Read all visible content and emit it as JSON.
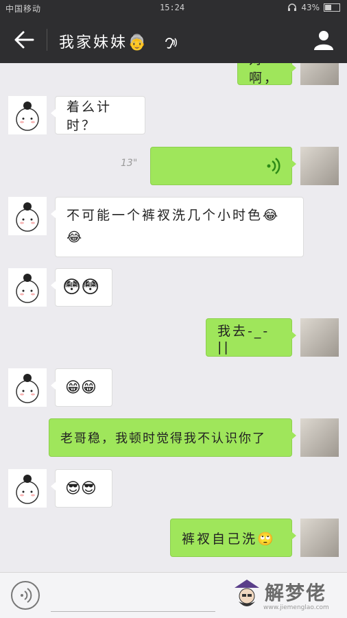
{
  "status_bar": {
    "carrier": "中国移动",
    "time": "15:24",
    "battery": "43%",
    "battery_level": 0.43
  },
  "header": {
    "title": "我家妹妹👵",
    "ear_icon": "ear-icon",
    "back_icon": "back-arrow-icon",
    "profile_icon": "person-icon"
  },
  "messages": [
    {
      "side": "right",
      "text": "对啊，"
    },
    {
      "side": "left",
      "text": "着么计时？"
    },
    {
      "side": "right",
      "type": "voice",
      "duration": "13\""
    },
    {
      "side": "left",
      "text": "不可能一个裤衩洗几个小时色😂😂"
    },
    {
      "side": "left",
      "text": "😳😳"
    },
    {
      "side": "right",
      "text": "我去-_-||"
    },
    {
      "side": "left",
      "text": "😁😁"
    },
    {
      "side": "right",
      "text": "老哥稳，我顿时觉得我不认识你了"
    },
    {
      "side": "left",
      "text": "😎😎"
    },
    {
      "side": "right",
      "text": "裤衩自己洗🙄"
    }
  ],
  "watermark": {
    "text": "解梦佬",
    "url": "www.jiemenglao.com"
  },
  "colors": {
    "header_bg": "#2e2e30",
    "chat_bg": "#ecebef",
    "sent_bubble": "#9fe65b",
    "received_bubble": "#ffffff"
  }
}
